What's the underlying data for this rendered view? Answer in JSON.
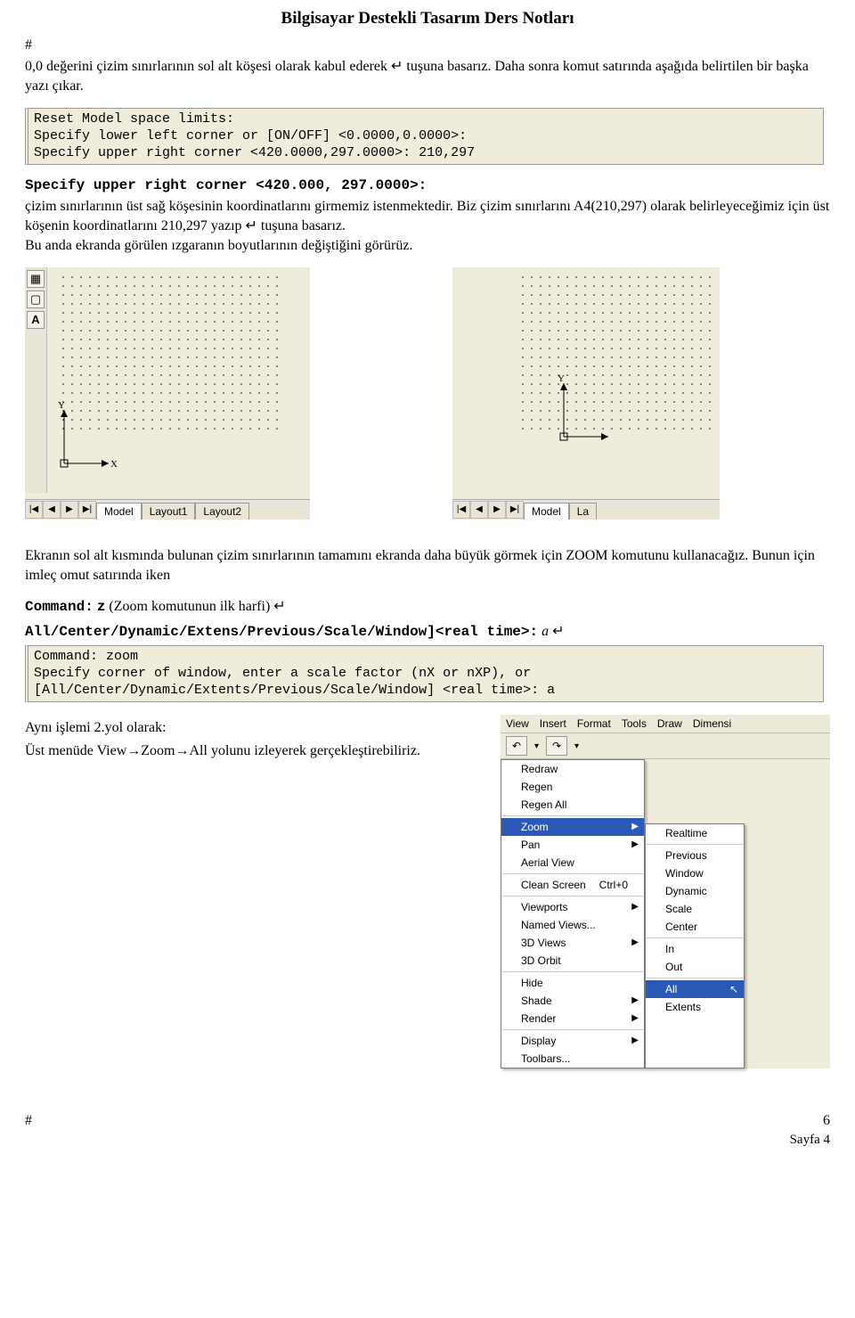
{
  "header": {
    "title": "Bilgisayar Destekli Tasarım Ders Notları"
  },
  "hash": "#",
  "para1": "0,0 değerini çizim sınırlarının sol alt köşesi olarak kabul ederek ↵ tuşuna basarız. Daha sonra komut satırında aşağıda belirtilen bir başka yazı çıkar.",
  "cmd1": {
    "l1": "Reset Model space limits:",
    "l2": "Specify lower left corner or [ON/OFF] <0.0000,0.0000>:",
    "l3": "Specify upper right corner <420.0000,297.0000>: 210,297"
  },
  "bold1": "Specify upper right corner <420.000, 297.0000>:",
  "para2": "çizim sınırlarının üst sağ köşesinin koordinatlarını girmemiz istenmektedir. Biz çizim sınırlarını A4(210,297) olarak belirleyeceğimiz için üst köşenin koordinatlarını 210,297 yazıp ↵ tuşuna basarız.",
  "para2b": "Bu anda ekranda görülen ızgaranın boyutlarının değiştiğini görürüz.",
  "panelA": {
    "tools": [
      "▦",
      "▢"
    ],
    "A": "A",
    "tabs_nav": [
      "|◀",
      "◀",
      "▶",
      "▶|"
    ],
    "tabs": [
      "Model",
      "Layout1",
      "Layout2"
    ]
  },
  "panelB": {
    "tabs_nav": [
      "|◀",
      "◀",
      "▶",
      "▶|"
    ],
    "tabs": [
      "Model",
      "La"
    ]
  },
  "para3": "Ekranın sol alt kısmında bulunan çizim sınırlarının tamamını ekranda daha büyük görmek için ZOOM komutunu kullanacağız. Bunun için imleç omut satırında iken",
  "command_z_label": "Command:",
  "command_z_value": "z",
  "command_z_note": "(Zoom komutunun ilk harfi) ↵",
  "all_line": "All/Center/Dynamic/Extens/Previous/Scale/Window]<real time>:",
  "all_val": "a",
  "enter": "↵",
  "cmd2": {
    "l1": "Command: zoom",
    "l2": "Specify corner of window, enter a scale factor (nX or nXP), or",
    "l3": "[All/Center/Dynamic/Extents/Previous/Scale/Window] <real time>: a"
  },
  "para4a": "Aynı işlemi 2.yol olarak:",
  "para4b": "Üst menüde View→Zoom→All yolunu izleyerek gerçekleştirebiliriz.",
  "menubar": [
    "View",
    "Insert",
    "Format",
    "Tools",
    "Draw",
    "Dimensi"
  ],
  "toolbar2": [
    "↶",
    "↷"
  ],
  "dropdown": {
    "group1": [
      "Redraw",
      "Regen",
      "Regen All"
    ],
    "zoom": "Zoom",
    "group2": [
      "Pan",
      "Aerial View"
    ],
    "clean": {
      "label": "Clean Screen",
      "shortcut": "Ctrl+0"
    },
    "group3": [
      "Viewports",
      "Named Views...",
      "3D Views",
      "3D Orbit"
    ],
    "group4": [
      "Hide",
      "Shade",
      "Render"
    ],
    "group5": [
      "Display",
      "Toolbars..."
    ]
  },
  "submenu": {
    "g1": [
      "Realtime",
      "Previous",
      "Window",
      "Dynamic",
      "Scale",
      "Center"
    ],
    "g2": [
      "In",
      "Out"
    ],
    "g3": [
      "All",
      "Extents"
    ]
  },
  "footer": {
    "left": "#",
    "right": "6",
    "page": "Sayfa 4"
  }
}
